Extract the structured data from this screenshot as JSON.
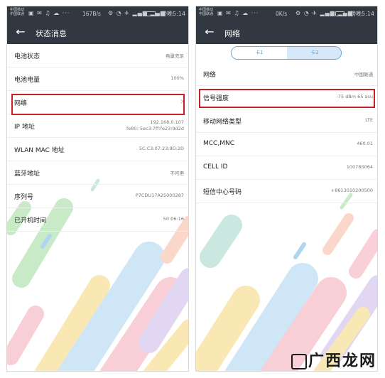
{
  "left": {
    "status": {
      "carrier_lines": [
        "中国移动",
        "中国联通"
      ],
      "speed": "167B/s",
      "time": "傍晚5:14"
    },
    "title": "状态消息",
    "rows": [
      {
        "label": "电池状态",
        "value": "电量充足"
      },
      {
        "label": "电池电量",
        "value": "100%"
      },
      {
        "label": "网络",
        "value": ""
      },
      {
        "label": "IP 地址",
        "value_line1": "192.168.0.107",
        "value_line2": "fe80::5ec3:7ff:fe23:9d2d"
      },
      {
        "label": "WLAN MAC 地址",
        "value": "5C:C3:07:23:9D:2D"
      },
      {
        "label": "蓝牙地址",
        "value": "不可用"
      },
      {
        "label": "序列号",
        "value": "P7CDU17A25000287"
      },
      {
        "label": "已开机时间",
        "value": "50:06:16"
      }
    ]
  },
  "right": {
    "status": {
      "carrier_lines": [
        "中国移动",
        "中国联通"
      ],
      "speed": "0K/s",
      "time": "傍晚5:14"
    },
    "title": "网络",
    "tabs": [
      "卡1",
      "卡2"
    ],
    "rows": [
      {
        "label": "网络",
        "value": "中国联通"
      },
      {
        "label": "信号强度",
        "value": "-75 dBm  65 asu"
      },
      {
        "label": "移动网络类型",
        "value": "LTE"
      },
      {
        "label": "MCC,MNC",
        "value": "460.01"
      },
      {
        "label": "CELL ID",
        "value": "100780064"
      },
      {
        "label": "短信中心号码",
        "value": "+8613010200500"
      }
    ]
  },
  "watermark": "广西龙网",
  "colors": {
    "bar": "#323841",
    "highlight": "#c8202a",
    "tab_accent": "#5aa7e2"
  }
}
